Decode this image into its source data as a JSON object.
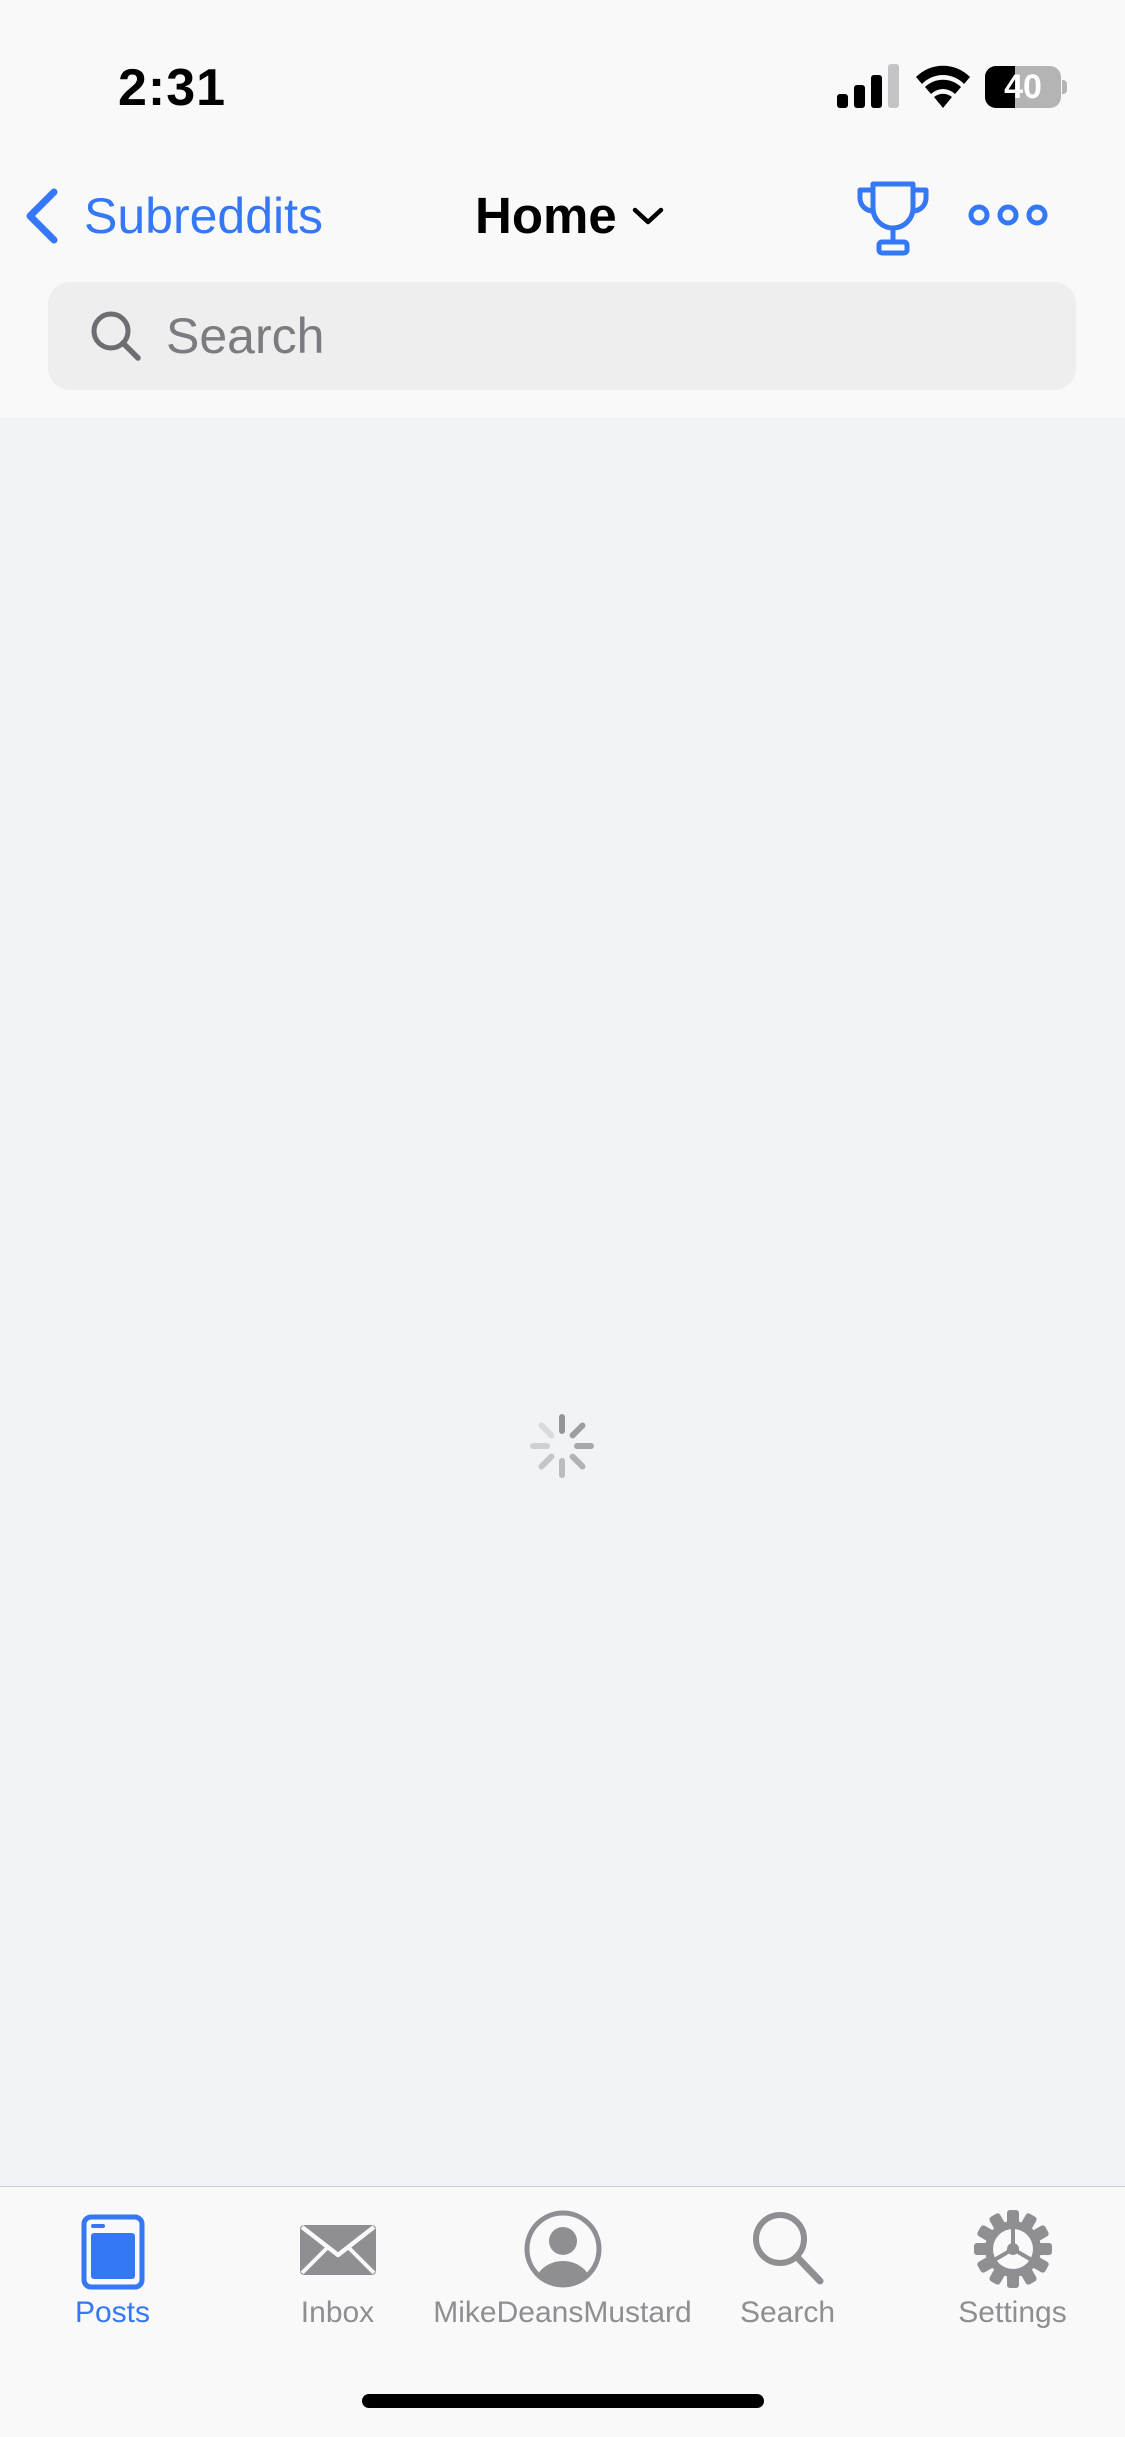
{
  "status_bar": {
    "time": "2:31",
    "battery_level": "40",
    "battery_fraction": 0.4,
    "signal_bars_active": 3,
    "signal_bars_total": 4
  },
  "nav": {
    "back_label": "Subreddits",
    "title": "Home",
    "trophy_icon": "trophy-icon",
    "more_icon": "ellipsis-icon"
  },
  "search": {
    "placeholder": "Search",
    "value": ""
  },
  "loading": {
    "icon": "activity-spinner"
  },
  "tabs": [
    {
      "label": "Posts",
      "icon": "posts-icon",
      "active": true
    },
    {
      "label": "Inbox",
      "icon": "envelope-icon",
      "active": false
    },
    {
      "label": "MikeDeansMustard",
      "icon": "profile-icon",
      "active": false
    },
    {
      "label": "Search",
      "icon": "search-icon",
      "active": false
    },
    {
      "label": "Settings",
      "icon": "gear-icon",
      "active": false
    }
  ],
  "colors": {
    "accent": "#3478F6",
    "inactive": "#8E8E93",
    "content_background": "#F2F3F7",
    "bar_background": "#F9F9F9",
    "search_background": "#EEEEEF"
  }
}
